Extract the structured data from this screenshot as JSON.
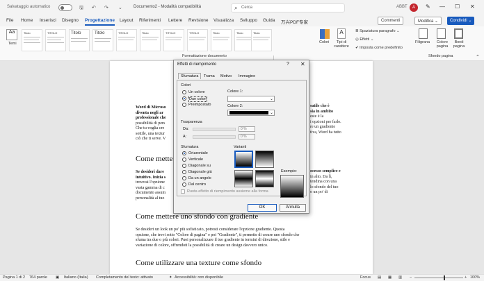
{
  "titlebar": {
    "autosave_label": "Salvataggio automatico",
    "doc_title": "Documento2 - Modalità compatibilità",
    "search_placeholder": "Cerca",
    "user": "ABBT",
    "avatar_letter": "A"
  },
  "menu": {
    "tabs": [
      "File",
      "Home",
      "Inserisci",
      "Disegno",
      "Progettazione",
      "Layout",
      "Riferimenti",
      "Lettere",
      "Revisione",
      "Visualizza",
      "Sviluppo",
      "Guida",
      "万兴PDF专家"
    ],
    "active_tab": "Progettazione",
    "commenti": "Commenti",
    "modifica": "Modifica",
    "condividi": "Condividi"
  },
  "ribbon": {
    "temi": "Temi",
    "colori": "Colori",
    "tipi_carattere": "Tipi di carattere",
    "spaziatura": "Spaziatura paragrafo",
    "effetti": "Effetti",
    "imposta": "Imposta come predefinito",
    "filigrana": "Filigrana",
    "colore_pagina": "Colore pagina",
    "bordi_pagina": "Bordi pagina",
    "group_format": "Formattazione documento",
    "group_sfondo": "Sfondo pagina",
    "style_titles": [
      "Titolo",
      "TITOLO",
      "Titolo",
      "Titolo",
      "TITOLO",
      "Titolo",
      "TITOLO",
      "TITOLO",
      "Titolo",
      "Titolo",
      "Titolo"
    ]
  },
  "document": {
    "p1_bold": "Word di Microso",
    "p1_rest": "diventa negli ar",
    "p1_3": "professionale che",
    "p1_4": "possibilità di pers",
    "p1_5": "Che tu voglia cre",
    "p1_6": "sottile, una textur",
    "p1_7": "ciò che ti serve. V",
    "right_1": "satile che è",
    "right_2": "sia in ambito",
    "right_3": "este è la",
    "right_4": "i opzioni per farlo.",
    "right_5": "re un gradiente",
    "right_6": "tiva, Word ha tutto",
    "heading1": "Come mette",
    "p2_1": "Se desideri dare",
    "p2_2": "intuitivo. Inizia s",
    "p2_3": "troverai l'opzione",
    "p2_4": "vasta gamma di c",
    "p2_5": "documento assum",
    "p2_6": "personalità al tuo",
    "right_7": "ocesso semplice e",
    "right_8": "in alto. Da lì,",
    "right_9": "tendina con una",
    "right_10": "lo sfondo del tuo",
    "right_11": "o un po' di",
    "heading2": "Come mettere uno sfondo con gradiente",
    "p3_1": "Se desideri un look un po' più sofisticato, potresti considerare l'opzione gradiente. Questa",
    "p3_2": "opzione, che trovi sotto \"Colore di pagina\" e poi \"Gradiente\", ti permette di creare uno sfondo che",
    "p3_3": "sfuma tra due o più colori. Puoi personalizzare il tuo gradiente in termini di direzione, stile e",
    "p3_4": "variazione di colore, offrendoti la possibilità di creare un design davvero unico.",
    "heading3": "Come utilizzare una texture come sfondo"
  },
  "dialog": {
    "title": "Effetti di riempimento",
    "help": "?",
    "close": "✕",
    "tabs": [
      "Sfumatura",
      "Trama",
      "Motivo",
      "Immagine"
    ],
    "active_tab": "Sfumatura",
    "colori_label": "Colori",
    "radio_un_colore": "Un colore",
    "radio_due_colori": "Due colori",
    "radio_preimpostato": "Preimpostato",
    "colore1_label": "Colore 1:",
    "colore2_label": "Colore 2:",
    "trasparenza_label": "Trasparenza",
    "da_label": "Da:",
    "a_label": "A:",
    "da_value": "0 %",
    "a_value": "0 %",
    "sfumatura_label": "Sfumatura",
    "styles": [
      "Orizzontale",
      "Verticale",
      "Diagonale su",
      "Diagonale giù",
      "Da un angolo",
      "Dal centro"
    ],
    "selected_style": "Orizzontale",
    "varianti_label": "Varianti",
    "esempio_label": "Esempio:",
    "ruota_label": "Ruota effetto di riempimento assieme alla forma",
    "ok": "OK",
    "annulla": "Annulla"
  },
  "status": {
    "page": "Pagina 1 di 2",
    "words": "764 parole",
    "lang": "Italiano (Italia)",
    "text_pred": "Completamento del testo: attivato",
    "access": "Accessibilità: non disponibile",
    "focus": "Focus",
    "zoom": "100%"
  }
}
